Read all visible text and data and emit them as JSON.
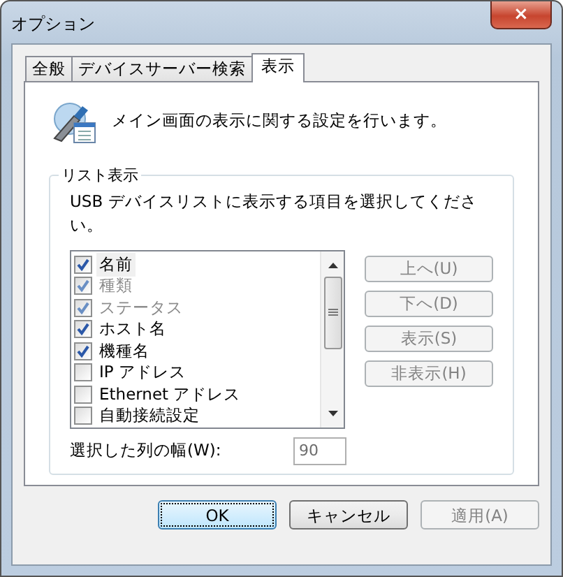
{
  "window": {
    "title": "オプション",
    "close": "×"
  },
  "tabs": [
    {
      "label": "全般",
      "selected": false
    },
    {
      "label": "デバイスサーバー検索",
      "selected": false
    },
    {
      "label": "表示",
      "selected": true
    }
  ],
  "description": "メイン画面の表示に関する設定を行います。",
  "group": {
    "title": "リスト表示",
    "instruction": "USB デバイスリストに表示する項目を選択してください。",
    "items": [
      {
        "label": "名前",
        "checked": true,
        "disabled": false,
        "selected": true
      },
      {
        "label": "種類",
        "checked": true,
        "disabled": true,
        "selected": false
      },
      {
        "label": "ステータス",
        "checked": true,
        "disabled": true,
        "selected": false
      },
      {
        "label": "ホスト名",
        "checked": true,
        "disabled": false,
        "selected": false
      },
      {
        "label": "機種名",
        "checked": true,
        "disabled": false,
        "selected": false
      },
      {
        "label": "IP アドレス",
        "checked": false,
        "disabled": false,
        "selected": false
      },
      {
        "label": "Ethernet アドレス",
        "checked": false,
        "disabled": false,
        "selected": false
      },
      {
        "label": "自動接続設定",
        "checked": false,
        "disabled": false,
        "selected": false
      }
    ],
    "side_buttons": [
      {
        "label": "上へ(U)",
        "disabled": true
      },
      {
        "label": "下へ(D)",
        "disabled": true
      },
      {
        "label": "表示(S)",
        "disabled": true
      },
      {
        "label": "非表示(H)",
        "disabled": true
      }
    ],
    "width_label": "選択した列の幅(W):",
    "width_value": "90",
    "width_disabled": true
  },
  "buttons": [
    {
      "label": "OK",
      "default": true,
      "disabled": false
    },
    {
      "label": "キャンセル",
      "default": false,
      "disabled": false
    },
    {
      "label": "適用(A)",
      "default": false,
      "disabled": true
    }
  ]
}
